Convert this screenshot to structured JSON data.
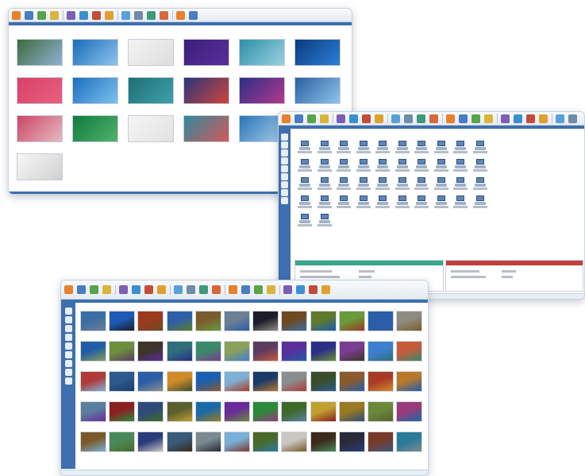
{
  "toolbar_icon_colors": [
    "#e9802c",
    "#4a7cc2",
    "#58a34b",
    "#d9b53c",
    "#7c5fb4",
    "#3b8fd0",
    "#c44b3a",
    "#e0a030",
    "#5aa0d8",
    "#6f8ca8",
    "#3c9a7a",
    "#d8683a"
  ],
  "window_top_left": {
    "thumbnails": [
      {
        "theme": "nature-bird",
        "colors": [
          "#3e6a3c",
          "#8fb2d5"
        ]
      },
      {
        "theme": "windows-7",
        "colors": [
          "#1b6bb8",
          "#8cc4ee"
        ]
      },
      {
        "theme": "blank-page",
        "colors": [
          "#f3f3f3",
          "#dedede"
        ]
      },
      {
        "theme": "windows-8-start",
        "colors": [
          "#3a1f78",
          "#5b2e9a"
        ]
      },
      {
        "theme": "seascape",
        "colors": [
          "#2d8fa9",
          "#9ad1e0"
        ]
      },
      {
        "theme": "windows-10",
        "colors": [
          "#0a3a80",
          "#2b7fd6"
        ]
      },
      {
        "theme": "pink-solid",
        "colors": [
          "#d9416a",
          "#e8607f"
        ]
      },
      {
        "theme": "windows-7",
        "colors": [
          "#1a6fbd",
          "#7fc1ee"
        ]
      },
      {
        "theme": "teal-abstract",
        "colors": [
          "#1f6e77",
          "#3da2a8"
        ]
      },
      {
        "theme": "windows-8-tiles",
        "colors": [
          "#28357a",
          "#d0453a"
        ]
      },
      {
        "theme": "windows-8-tiles",
        "colors": [
          "#2a2f86",
          "#b3398e"
        ]
      },
      {
        "theme": "windows-10-light",
        "colors": [
          "#2a5f9e",
          "#8fc5ee"
        ]
      },
      {
        "theme": "pink-floral",
        "colors": [
          "#c94663",
          "#e8b9c4"
        ]
      },
      {
        "theme": "green-gradient",
        "colors": [
          "#0f7a3e",
          "#53b36b"
        ]
      },
      {
        "theme": "blank-page",
        "colors": [
          "#f5f5f5",
          "#e2e2e2"
        ]
      },
      {
        "theme": "sea-coast",
        "colors": [
          "#2f8a9c",
          "#d3585a"
        ]
      },
      {
        "theme": "partial-blue",
        "colors": [
          "#2874b7",
          "#a8cde9"
        ]
      },
      {
        "theme": "text-doc",
        "colors": [
          "#f7f7f7",
          "#d5d5d5"
        ]
      },
      {
        "theme": "text-doc",
        "colors": [
          "#f7f7f7",
          "#d0d0d0"
        ]
      }
    ]
  },
  "window_right": {
    "computer_count": 42,
    "panels": [
      {
        "header_color": "#3aa58a"
      },
      {
        "header_color": "#c0403e"
      }
    ]
  },
  "window_bottom": {
    "wallpaper_colors": [
      [
        "#3b6ea3",
        "#1d5ab6",
        "#9a3a1f",
        "#2d5fa8",
        "#7a5d2d",
        "#6d7f94",
        "#1c1d2b",
        "#6e4a22",
        "#5f7b2a",
        "#6a9a3a",
        "#2b5ea8",
        "#8e8c7e"
      ],
      [
        "#1f5ea7",
        "#6d8f3b",
        "#3c3528",
        "#2e6f7a",
        "#3a8a6a",
        "#8aa05b",
        "#5d3b61",
        "#5b2e9a",
        "#2a2f86",
        "#7a3d90",
        "#3e7fd0",
        "#c65b3a"
      ],
      [
        "#b03a3a",
        "#2d5a8c",
        "#2a5ea6",
        "#d08a2a",
        "#1b5fb0",
        "#7fb0d5",
        "#1a3a6a",
        "#8a8f8e",
        "#3a4d2a",
        "#8a5a2c",
        "#a83b26",
        "#b7782c"
      ],
      [
        "#5a7f9e",
        "#8a2020",
        "#2d4a7a",
        "#5a5f30",
        "#1a6aa8",
        "#6a2a9a",
        "#2a8a3a",
        "#3d6a2a",
        "#c0a030",
        "#9a7a20",
        "#6a8a3a",
        "#9a3a78"
      ],
      [
        "#7a5a2a",
        "#4a8a5a",
        "#2a3a7a",
        "#3a5a7a",
        "#7a8a8e",
        "#7ab0d8",
        "#4a6a2a",
        "#c9c6c0",
        "#3a2a1a",
        "#2a2a3a",
        "#7a3a2a",
        "#2a7a9a"
      ]
    ]
  }
}
